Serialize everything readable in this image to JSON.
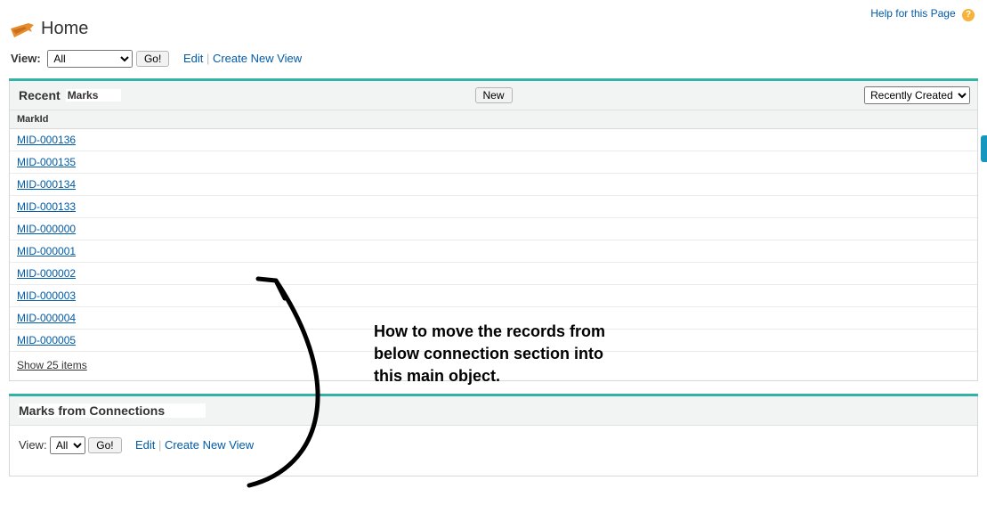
{
  "help": {
    "label": "Help for this Page"
  },
  "header": {
    "title": "Home"
  },
  "viewbar": {
    "label": "View:",
    "selected": "All",
    "go": "Go!",
    "edit": "Edit",
    "create": "Create New View"
  },
  "recent": {
    "title_a": "Recent",
    "title_b": "Marks",
    "new_btn": "New",
    "sort_selected": "Recently Created",
    "column": "MarkId",
    "rows": [
      "MID-000136",
      "MID-000135",
      "MID-000134",
      "MID-000133",
      "MID-000000",
      "MID-000001",
      "MID-000002",
      "MID-000003",
      "MID-000004",
      "MID-000005"
    ],
    "show_more": "Show 25 items"
  },
  "connections": {
    "title": "Marks from Connections",
    "view_label": "View:",
    "selected": "All",
    "go": "Go!",
    "edit": "Edit",
    "create": "Create New View"
  },
  "annotation": {
    "text": "How to move the records from\nbelow connection section into\nthis main object."
  }
}
